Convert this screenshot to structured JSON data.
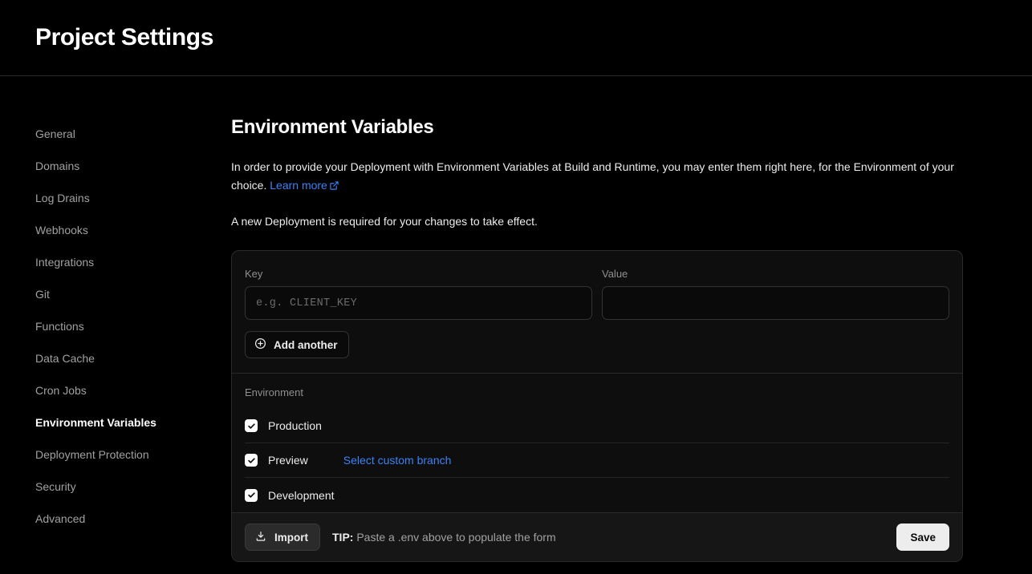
{
  "header": {
    "title": "Project Settings"
  },
  "sidebar": {
    "items": [
      {
        "label": "General",
        "active": false
      },
      {
        "label": "Domains",
        "active": false
      },
      {
        "label": "Log Drains",
        "active": false
      },
      {
        "label": "Webhooks",
        "active": false
      },
      {
        "label": "Integrations",
        "active": false
      },
      {
        "label": "Git",
        "active": false
      },
      {
        "label": "Functions",
        "active": false
      },
      {
        "label": "Data Cache",
        "active": false
      },
      {
        "label": "Cron Jobs",
        "active": false
      },
      {
        "label": "Environment Variables",
        "active": true
      },
      {
        "label": "Deployment Protection",
        "active": false
      },
      {
        "label": "Security",
        "active": false
      },
      {
        "label": "Advanced",
        "active": false
      }
    ]
  },
  "main": {
    "section_title": "Environment Variables",
    "intro_text": "In order to provide your Deployment with Environment Variables at Build and Runtime, you may enter them right here, for the Environment of your choice. ",
    "learn_more_label": "Learn more",
    "deployment_note": "A new Deployment is required for your changes to take effect.",
    "form": {
      "key_label": "Key",
      "key_value": "",
      "key_placeholder": "e.g. CLIENT_KEY",
      "value_label": "Value",
      "value_value": "",
      "value_placeholder": "",
      "add_another_label": "Add another"
    },
    "environment": {
      "label": "Environment",
      "rows": [
        {
          "name": "Production",
          "checked": true,
          "link": ""
        },
        {
          "name": "Preview",
          "checked": true,
          "link": "Select custom branch"
        },
        {
          "name": "Development",
          "checked": true,
          "link": ""
        }
      ]
    },
    "footer": {
      "import_label": "Import",
      "tip_prefix": "TIP:",
      "tip_text": "Paste a .env above to populate the form",
      "save_label": "Save"
    }
  },
  "colors": {
    "page_bg": "#000000",
    "card_bg": "#0e0e0e",
    "border": "#2a2a2a",
    "accent_link": "#3b82f6",
    "text_primary": "#ededed",
    "text_muted": "#8f8f8f",
    "save_bg": "#ededed"
  }
}
